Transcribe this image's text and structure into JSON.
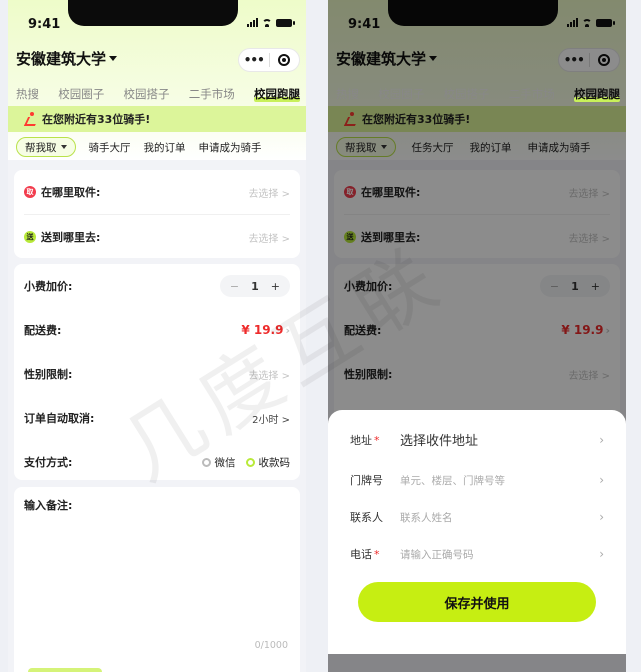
{
  "status": {
    "time": "9:41"
  },
  "header": {
    "university": "安徽建筑大学",
    "more_icon": "more-dots-icon",
    "target_icon": "target-icon"
  },
  "tabs": [
    "热搜",
    "校园圈子",
    "校园搭子",
    "二手市场",
    "校园跑腿"
  ],
  "active_tab": "校园跑腿",
  "banner": {
    "text": "在您附近有33位骑手!",
    "icon": "runner-icon"
  },
  "subtabs_left": {
    "selected": "帮我取",
    "items": [
      "骑手大厅",
      "我的订单",
      "申请成为骑手"
    ]
  },
  "subtabs_right": {
    "selected": "帮我取",
    "items": [
      "任务大厅",
      "我的订单",
      "申请成为骑手"
    ]
  },
  "location": {
    "pickup": {
      "badge": "取",
      "label": "在哪里取件:",
      "value": "去选择 >"
    },
    "dropoff": {
      "badge": "送",
      "label": "送到哪里去:",
      "value": "去选择 >"
    }
  },
  "order": {
    "tip": {
      "label": "小费加价:",
      "minus": "−",
      "value": "1",
      "plus": "+"
    },
    "delivery_fee": {
      "label": "配送费:",
      "value": "¥ 19.9"
    },
    "gender": {
      "label": "性别限制:",
      "value": "去选择 >"
    },
    "auto_cancel": {
      "label": "订单自动取消:",
      "value": "2小时 >"
    },
    "payment": {
      "label": "支付方式:",
      "option1": "微信",
      "option2": "收款码"
    }
  },
  "remark": {
    "label": "输入备注:",
    "counter": "0/1000"
  },
  "address_form": {
    "address": {
      "label": "地址",
      "required": "*",
      "value": "选择收件地址"
    },
    "door": {
      "label": "门牌号",
      "placeholder": "单元、楼层、门牌号等"
    },
    "contact": {
      "label": "联系人",
      "placeholder": "联系人姓名"
    },
    "phone": {
      "label": "电话",
      "required": "*",
      "placeholder": "请输入正确号码"
    },
    "save_button": "保存并使用"
  },
  "watermark": "几度互联",
  "colors": {
    "accent": "#c6ee12",
    "price": "#ee2b2b",
    "banner": "#dcf59a"
  }
}
